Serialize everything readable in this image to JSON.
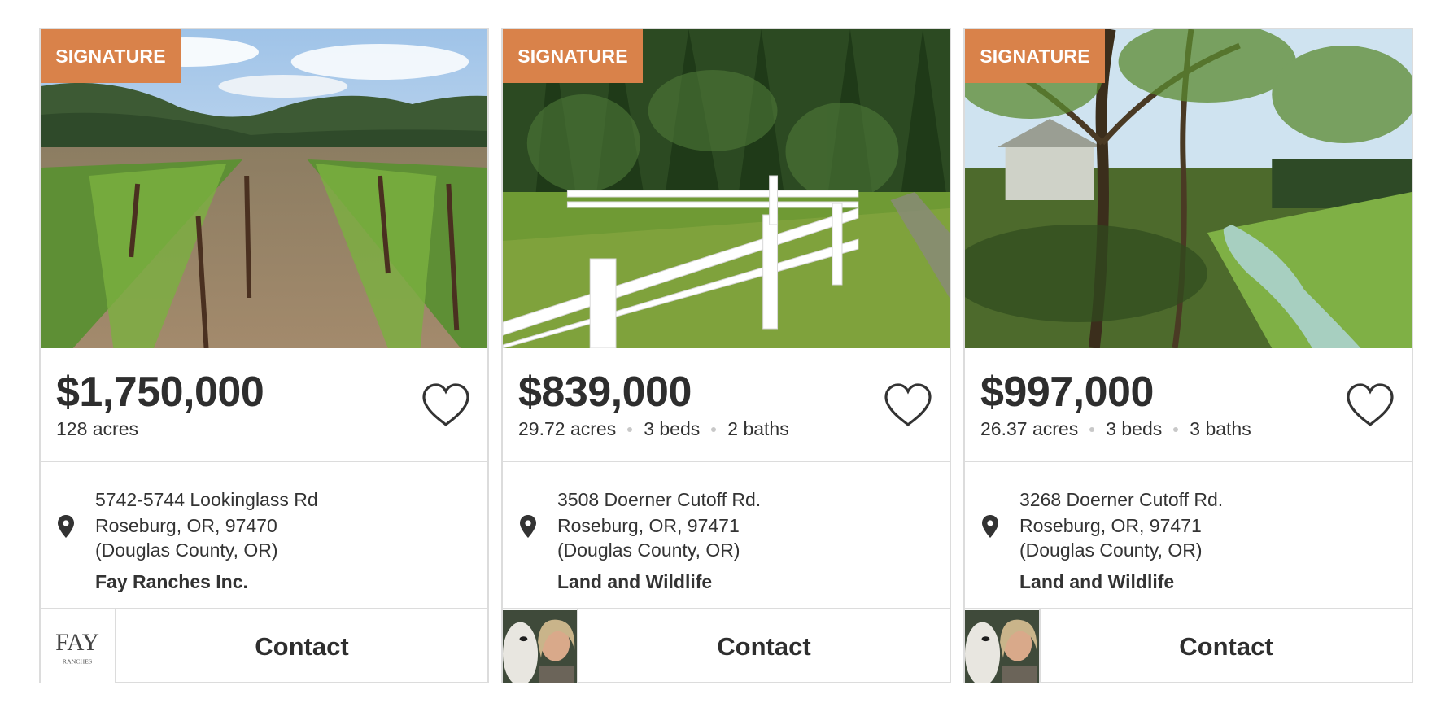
{
  "listings": [
    {
      "badge": "SIGNATURE",
      "price": "$1,750,000",
      "specs": [
        "128 acres"
      ],
      "address_line1": "5742-5744 Lookinglass Rd",
      "address_line2": "Roseburg, OR, 97470",
      "address_line3": "(Douglas County, OR)",
      "agent": "Fay Ranches Inc.",
      "logo_text": "FAY",
      "logo_subtext": "RANCHES",
      "contact_label": "Contact",
      "photo": "vineyard-photo"
    },
    {
      "badge": "SIGNATURE",
      "price": "$839,000",
      "specs": [
        "29.72 acres",
        "3 beds",
        "2 baths"
      ],
      "address_line1": "3508 Doerner Cutoff Rd.",
      "address_line2": "Roseburg, OR, 97471",
      "address_line3": "(Douglas County, OR)",
      "agent": "Land and Wildlife",
      "contact_label": "Contact",
      "photo": "white-fence-photo"
    },
    {
      "badge": "SIGNATURE",
      "price": "$997,000",
      "specs": [
        "26.37 acres",
        "3 beds",
        "3 baths"
      ],
      "address_line1": "3268 Doerner Cutoff Rd.",
      "address_line2": "Roseburg, OR, 97471",
      "address_line3": "(Douglas County, OR)",
      "agent": "Land and Wildlife",
      "contact_label": "Contact",
      "photo": "creek-photo"
    }
  ],
  "colors": {
    "badge": "#d9824a",
    "border": "#dcdcdc",
    "text": "#333333"
  },
  "icons": {
    "favorite": "heart-icon",
    "location": "map-pin-icon"
  }
}
